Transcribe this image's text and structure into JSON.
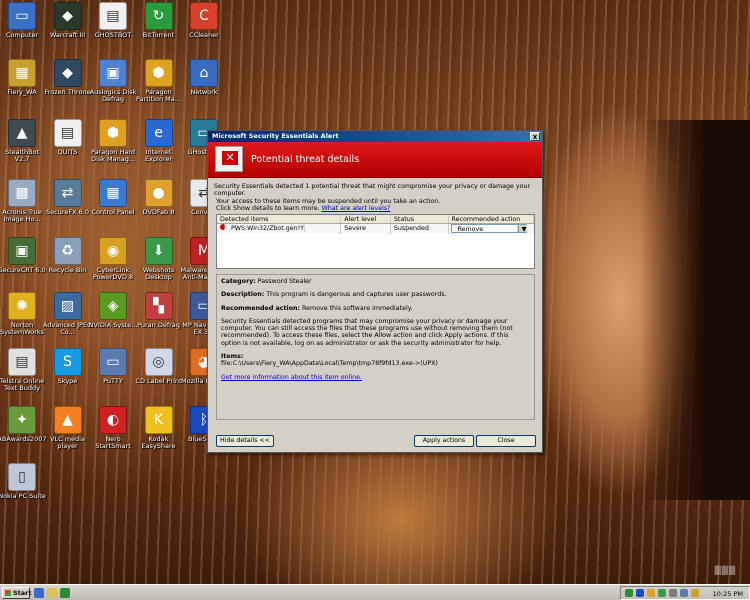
{
  "desktop_icons": [
    {
      "label": "Computer",
      "icon": "computer-icon",
      "color": "#3b6fc8",
      "glyph": "▭"
    },
    {
      "label": "Warcraft III",
      "icon": "warcraft-icon",
      "color": "#2a3a2a",
      "glyph": "◆"
    },
    {
      "label": "GHOSTBOT",
      "icon": "document-icon",
      "color": "#f0f0f0",
      "glyph": "▤"
    },
    {
      "label": "BitTorrent",
      "icon": "bittorrent-icon",
      "color": "#2a9a3a",
      "glyph": "↻"
    },
    {
      "label": "CCleaner",
      "icon": "ccleaner-icon",
      "color": "#d8402a",
      "glyph": "C"
    },
    {
      "label": "Fiery_WA",
      "icon": "folder-user-icon",
      "color": "#c8a030",
      "glyph": "▦"
    },
    {
      "label": "Frozen Throne",
      "icon": "frozen-throne-icon",
      "color": "#304860",
      "glyph": "◆"
    },
    {
      "label": "Auslogics Disk Defrag",
      "icon": "defrag-icon",
      "color": "#5080d0",
      "glyph": "▣"
    },
    {
      "label": "Paragon Partition Ma...",
      "icon": "paragon-icon",
      "color": "#e0a020",
      "glyph": "⬢"
    },
    {
      "label": "Network",
      "icon": "network-icon",
      "color": "#3a6ac0",
      "glyph": "⌂"
    },
    {
      "label": "StealthBot V2.7",
      "icon": "stealthbot-icon",
      "color": "#404850",
      "glyph": "▲"
    },
    {
      "label": "QUITS",
      "icon": "document-icon",
      "color": "#f0f0f0",
      "glyph": "▤"
    },
    {
      "label": "Paragon Hard Disk Manag...",
      "icon": "paragon-icon",
      "color": "#e0a020",
      "glyph": "⬢"
    },
    {
      "label": "Internet Explorer",
      "icon": "internet-explorer-icon",
      "color": "#2a6ad0",
      "glyph": "e"
    },
    {
      "label": "GHostOne",
      "icon": "ghostone-icon",
      "color": "#2a7a9a",
      "glyph": "▭"
    },
    {
      "label": "Acronis True Image Ho...",
      "icon": "acronis-icon",
      "color": "#9aaac0",
      "glyph": "▩"
    },
    {
      "label": "SecureFX 6.0",
      "icon": "securefx-icon",
      "color": "#5a7a9a",
      "glyph": "⇄"
    },
    {
      "label": "Control Panel",
      "icon": "control-panel-icon",
      "color": "#3a7ad0",
      "glyph": "▦"
    },
    {
      "label": "DVDFab 8",
      "icon": "dvdfab-icon",
      "color": "#e0a030",
      "glyph": "●"
    },
    {
      "label": "Convert",
      "icon": "convert-icon",
      "color": "#e8e8e8",
      "glyph": "⇄"
    },
    {
      "label": "SecureCRT 6.0",
      "icon": "securecrt-icon",
      "color": "#4a6a3a",
      "glyph": "▣"
    },
    {
      "label": "Recycle Bin",
      "icon": "recycle-bin-icon",
      "color": "#8aa0b8",
      "glyph": "♻"
    },
    {
      "label": "CyberLink PowerDVD 8",
      "icon": "powerdvd-icon",
      "color": "#d8a020",
      "glyph": "◉"
    },
    {
      "label": "Webshots Desktop",
      "icon": "webshots-icon",
      "color": "#3a9a4a",
      "glyph": "⬇"
    },
    {
      "label": "Malwarebytes' Anti-Malware",
      "icon": "malwarebytes-icon",
      "color": "#c02020",
      "glyph": "M"
    },
    {
      "label": "Norton SystemWorks",
      "icon": "norton-icon",
      "color": "#e0b020",
      "glyph": "✺"
    },
    {
      "label": "Advanced JPEG Co...",
      "icon": "jpeg-icon",
      "color": "#3a6aa0",
      "glyph": "▨"
    },
    {
      "label": "NVIDIA Syste...",
      "icon": "nvidia-icon",
      "color": "#5a9a20",
      "glyph": "◈"
    },
    {
      "label": "Puran Defrag",
      "icon": "puran-defrag-icon",
      "color": "#c04040",
      "glyph": "▚"
    },
    {
      "label": "MP Navigator EX 3.0",
      "icon": "mp-navigator-icon",
      "color": "#3a5a9a",
      "glyph": "▭"
    },
    {
      "label": "Telstra Online Text Buddy",
      "icon": "telstra-icon",
      "color": "#e0e0e0",
      "glyph": "▤"
    },
    {
      "label": "Skype",
      "icon": "skype-icon",
      "color": "#1a9ae0",
      "glyph": "S"
    },
    {
      "label": "PuTTY",
      "icon": "putty-icon",
      "color": "#5a7ab0",
      "glyph": "▭"
    },
    {
      "label": "CD Label Print",
      "icon": "cd-label-icon",
      "color": "#d0d8e8",
      "glyph": "◎"
    },
    {
      "label": "Mozilla Firefox",
      "icon": "firefox-icon",
      "color": "#e06a20",
      "glyph": "◕"
    },
    {
      "label": "ABAwards2007",
      "icon": "abawards-icon",
      "color": "#6a9a3a",
      "glyph": "✦"
    },
    {
      "label": "VLC media player",
      "icon": "vlc-icon",
      "color": "#f08020",
      "glyph": "▲"
    },
    {
      "label": "Nero StartSmart",
      "icon": "nero-icon",
      "color": "#d02020",
      "glyph": "◐"
    },
    {
      "label": "Kodak EasyShare",
      "icon": "kodak-icon",
      "color": "#f0c020",
      "glyph": "K"
    },
    {
      "label": "BlueSoleil",
      "icon": "bluetooth-icon",
      "color": "#1a4ac0",
      "glyph": "ᛒ"
    },
    {
      "label": "Nokia PC Suite",
      "icon": "nokia-icon",
      "color": "#c0c8d8",
      "glyph": "▯"
    }
  ],
  "dialog": {
    "title": "Microsoft Security Essentials Alert",
    "close_glyph": "x",
    "heading": "Potential threat details",
    "intro_line1": "Security Essentials detected 1 potential threat that might compromise your privacy or damage your computer.",
    "intro_line2": "Your access to these items may be suspended until you take an action.",
    "intro_line3": "Click Show details to learn more.",
    "intro_link": "What are alert levels?",
    "columns": [
      "Detected items",
      "Alert level",
      "Status",
      "Recommended action"
    ],
    "item": {
      "name": "PWS:Win32/Zbot.gen!Y",
      "level": "Severe",
      "status": "Suspended",
      "action": "Remove"
    },
    "category_label": "Category:",
    "category_value": "Password Stealer",
    "description_label": "Description:",
    "description_value": "This program is dangerous and captures user passwords.",
    "recommended_label": "Recommended action:",
    "recommended_value": "Remove this software immediately.",
    "details_paragraph": "Security Essentials detected programs that may compromise your privacy or damage your computer. You can still access the files that these programs use without removing them (not recommended). To access these files, select the Allow action and click Apply actions. If this option is not available, log on as administrator or ask the security administrator for help.",
    "items_label": "Items:",
    "items_value": "file:C:\\Users\\Fiery_WA\\AppData\\Local\\Temp\\tmp78f9fd13.exe->(UPX)",
    "more_info_link": "Get more information about this item online.",
    "hide_details_button": "Hide details <<",
    "apply_button": "Apply actions",
    "close_button": "Close"
  },
  "taskbar": {
    "start_label": "Start",
    "clock": "10:25 PM"
  }
}
